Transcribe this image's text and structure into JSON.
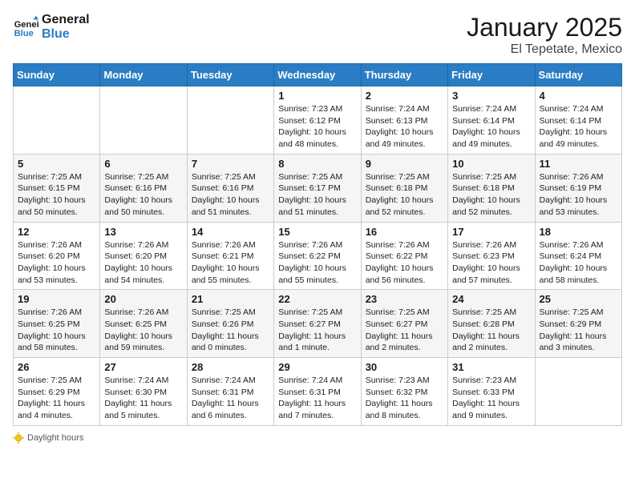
{
  "header": {
    "logo_general": "General",
    "logo_blue": "Blue",
    "month_title": "January 2025",
    "location": "El Tepetate, Mexico"
  },
  "weekdays": [
    "Sunday",
    "Monday",
    "Tuesday",
    "Wednesday",
    "Thursday",
    "Friday",
    "Saturday"
  ],
  "weeks": [
    [
      {
        "day": "",
        "sunrise": "",
        "sunset": "",
        "daylight": ""
      },
      {
        "day": "",
        "sunrise": "",
        "sunset": "",
        "daylight": ""
      },
      {
        "day": "",
        "sunrise": "",
        "sunset": "",
        "daylight": ""
      },
      {
        "day": "1",
        "sunrise": "Sunrise: 7:23 AM",
        "sunset": "Sunset: 6:12 PM",
        "daylight": "Daylight: 10 hours and 48 minutes."
      },
      {
        "day": "2",
        "sunrise": "Sunrise: 7:24 AM",
        "sunset": "Sunset: 6:13 PM",
        "daylight": "Daylight: 10 hours and 49 minutes."
      },
      {
        "day": "3",
        "sunrise": "Sunrise: 7:24 AM",
        "sunset": "Sunset: 6:14 PM",
        "daylight": "Daylight: 10 hours and 49 minutes."
      },
      {
        "day": "4",
        "sunrise": "Sunrise: 7:24 AM",
        "sunset": "Sunset: 6:14 PM",
        "daylight": "Daylight: 10 hours and 49 minutes."
      }
    ],
    [
      {
        "day": "5",
        "sunrise": "Sunrise: 7:25 AM",
        "sunset": "Sunset: 6:15 PM",
        "daylight": "Daylight: 10 hours and 50 minutes."
      },
      {
        "day": "6",
        "sunrise": "Sunrise: 7:25 AM",
        "sunset": "Sunset: 6:16 PM",
        "daylight": "Daylight: 10 hours and 50 minutes."
      },
      {
        "day": "7",
        "sunrise": "Sunrise: 7:25 AM",
        "sunset": "Sunset: 6:16 PM",
        "daylight": "Daylight: 10 hours and 51 minutes."
      },
      {
        "day": "8",
        "sunrise": "Sunrise: 7:25 AM",
        "sunset": "Sunset: 6:17 PM",
        "daylight": "Daylight: 10 hours and 51 minutes."
      },
      {
        "day": "9",
        "sunrise": "Sunrise: 7:25 AM",
        "sunset": "Sunset: 6:18 PM",
        "daylight": "Daylight: 10 hours and 52 minutes."
      },
      {
        "day": "10",
        "sunrise": "Sunrise: 7:25 AM",
        "sunset": "Sunset: 6:18 PM",
        "daylight": "Daylight: 10 hours and 52 minutes."
      },
      {
        "day": "11",
        "sunrise": "Sunrise: 7:26 AM",
        "sunset": "Sunset: 6:19 PM",
        "daylight": "Daylight: 10 hours and 53 minutes."
      }
    ],
    [
      {
        "day": "12",
        "sunrise": "Sunrise: 7:26 AM",
        "sunset": "Sunset: 6:20 PM",
        "daylight": "Daylight: 10 hours and 53 minutes."
      },
      {
        "day": "13",
        "sunrise": "Sunrise: 7:26 AM",
        "sunset": "Sunset: 6:20 PM",
        "daylight": "Daylight: 10 hours and 54 minutes."
      },
      {
        "day": "14",
        "sunrise": "Sunrise: 7:26 AM",
        "sunset": "Sunset: 6:21 PM",
        "daylight": "Daylight: 10 hours and 55 minutes."
      },
      {
        "day": "15",
        "sunrise": "Sunrise: 7:26 AM",
        "sunset": "Sunset: 6:22 PM",
        "daylight": "Daylight: 10 hours and 55 minutes."
      },
      {
        "day": "16",
        "sunrise": "Sunrise: 7:26 AM",
        "sunset": "Sunset: 6:22 PM",
        "daylight": "Daylight: 10 hours and 56 minutes."
      },
      {
        "day": "17",
        "sunrise": "Sunrise: 7:26 AM",
        "sunset": "Sunset: 6:23 PM",
        "daylight": "Daylight: 10 hours and 57 minutes."
      },
      {
        "day": "18",
        "sunrise": "Sunrise: 7:26 AM",
        "sunset": "Sunset: 6:24 PM",
        "daylight": "Daylight: 10 hours and 58 minutes."
      }
    ],
    [
      {
        "day": "19",
        "sunrise": "Sunrise: 7:26 AM",
        "sunset": "Sunset: 6:25 PM",
        "daylight": "Daylight: 10 hours and 58 minutes."
      },
      {
        "day": "20",
        "sunrise": "Sunrise: 7:26 AM",
        "sunset": "Sunset: 6:25 PM",
        "daylight": "Daylight: 10 hours and 59 minutes."
      },
      {
        "day": "21",
        "sunrise": "Sunrise: 7:25 AM",
        "sunset": "Sunset: 6:26 PM",
        "daylight": "Daylight: 11 hours and 0 minutes."
      },
      {
        "day": "22",
        "sunrise": "Sunrise: 7:25 AM",
        "sunset": "Sunset: 6:27 PM",
        "daylight": "Daylight: 11 hours and 1 minute."
      },
      {
        "day": "23",
        "sunrise": "Sunrise: 7:25 AM",
        "sunset": "Sunset: 6:27 PM",
        "daylight": "Daylight: 11 hours and 2 minutes."
      },
      {
        "day": "24",
        "sunrise": "Sunrise: 7:25 AM",
        "sunset": "Sunset: 6:28 PM",
        "daylight": "Daylight: 11 hours and 2 minutes."
      },
      {
        "day": "25",
        "sunrise": "Sunrise: 7:25 AM",
        "sunset": "Sunset: 6:29 PM",
        "daylight": "Daylight: 11 hours and 3 minutes."
      }
    ],
    [
      {
        "day": "26",
        "sunrise": "Sunrise: 7:25 AM",
        "sunset": "Sunset: 6:29 PM",
        "daylight": "Daylight: 11 hours and 4 minutes."
      },
      {
        "day": "27",
        "sunrise": "Sunrise: 7:24 AM",
        "sunset": "Sunset: 6:30 PM",
        "daylight": "Daylight: 11 hours and 5 minutes."
      },
      {
        "day": "28",
        "sunrise": "Sunrise: 7:24 AM",
        "sunset": "Sunset: 6:31 PM",
        "daylight": "Daylight: 11 hours and 6 minutes."
      },
      {
        "day": "29",
        "sunrise": "Sunrise: 7:24 AM",
        "sunset": "Sunset: 6:31 PM",
        "daylight": "Daylight: 11 hours and 7 minutes."
      },
      {
        "day": "30",
        "sunrise": "Sunrise: 7:23 AM",
        "sunset": "Sunset: 6:32 PM",
        "daylight": "Daylight: 11 hours and 8 minutes."
      },
      {
        "day": "31",
        "sunrise": "Sunrise: 7:23 AM",
        "sunset": "Sunset: 6:33 PM",
        "daylight": "Daylight: 11 hours and 9 minutes."
      },
      {
        "day": "",
        "sunrise": "",
        "sunset": "",
        "daylight": ""
      }
    ]
  ],
  "footer": {
    "daylight_label": "Daylight hours"
  },
  "colors": {
    "header_bg": "#2a7dc4",
    "logo_blue": "#2a7dc4"
  }
}
